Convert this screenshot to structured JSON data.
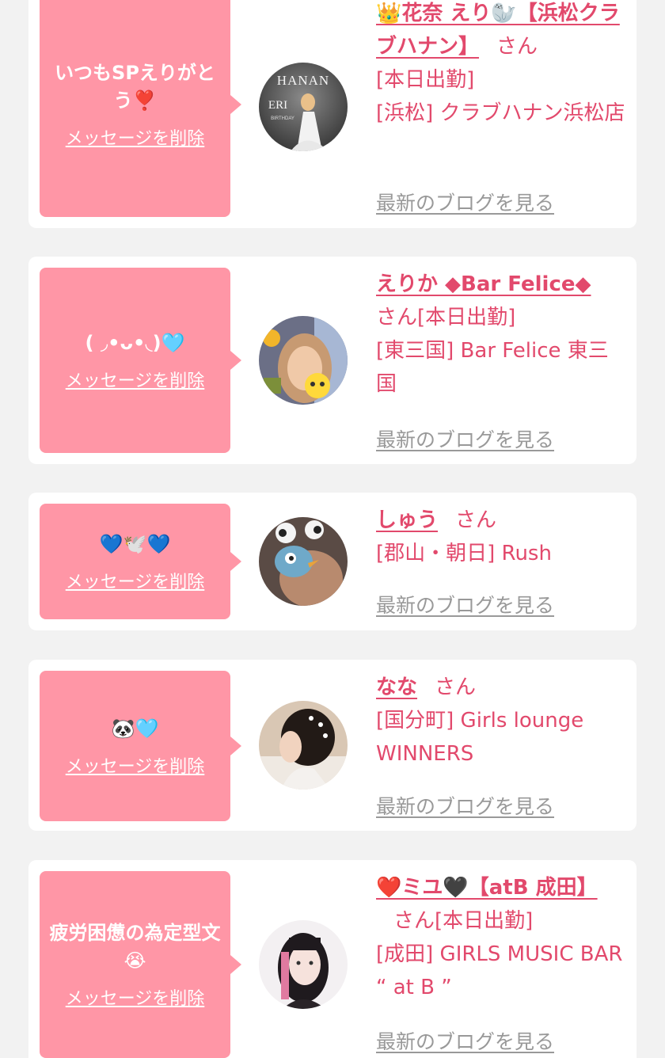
{
  "delete_label": "メッセージを削除",
  "blog_label": "最新のブログを見る",
  "san_label": "さん",
  "colors": {
    "bubble": "#ff96a6",
    "accent": "#e2496c",
    "blog_link": "#999999",
    "background": "#f2f2f2"
  },
  "items": [
    {
      "message": "いつもSPえりがとう❣️",
      "name": "👑花奈 えり🦭【浜松クラブハナン】",
      "status": "[本日出勤]",
      "location": "[浜松] クラブハナン浜松店",
      "avatar_text": [
        "HANAN",
        "ERI",
        "BIRTHDAY"
      ]
    },
    {
      "message": "( ◞•ᴗ•◟)🩵",
      "name": "えりか ◆Bar Felice◆",
      "status": "[本日出勤]",
      "location": "[東三国] Bar Felice 東三国"
    },
    {
      "message": "💙🕊️💙",
      "name": "しゅう",
      "status": "",
      "location": "[郡山・朝日] Rush"
    },
    {
      "message": "🐼🩵",
      "name": "なな",
      "status": "",
      "location": "[国分町] Girls lounge WINNERS"
    },
    {
      "message": "疲労困憊の為定型文😭",
      "name": "❤️ミユ🖤【atB 成田】",
      "status": "[本日出勤]",
      "location": "[成田] GIRLS MUSIC BAR “ at B ”"
    }
  ]
}
